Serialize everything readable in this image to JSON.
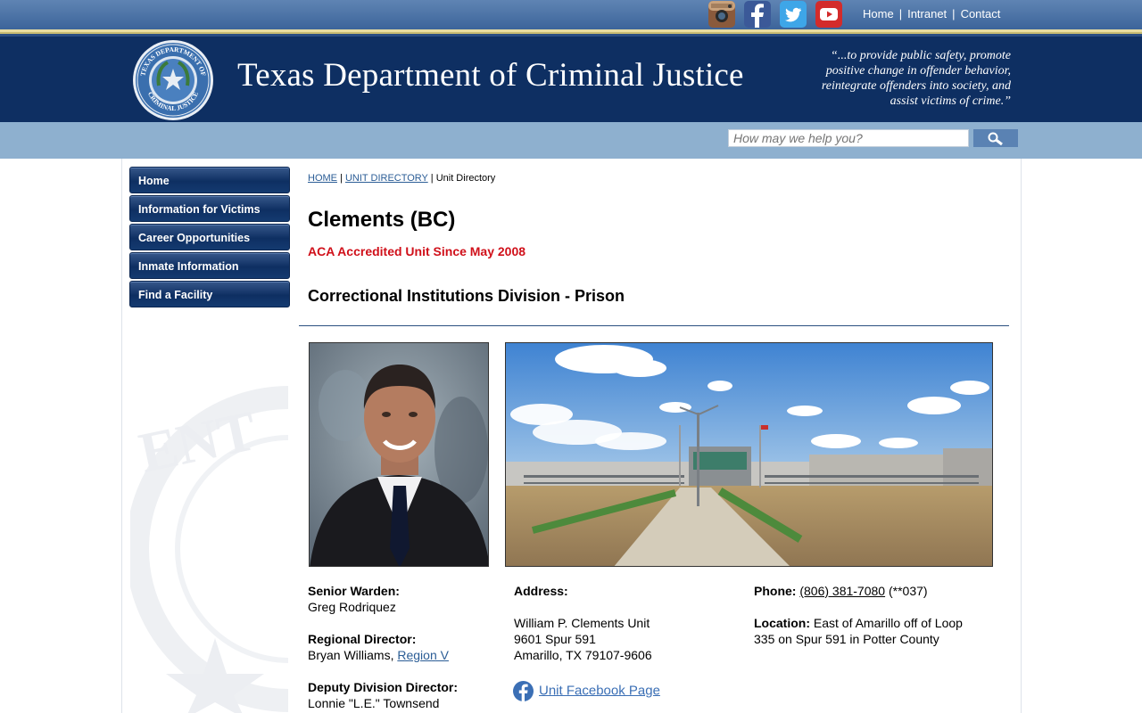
{
  "top": {
    "links": [
      "Home",
      "Intranet",
      "Contact"
    ],
    "social": [
      {
        "name": "instagram-icon",
        "color": "#8a5a3c"
      },
      {
        "name": "facebook-icon",
        "color": "#3b5998"
      },
      {
        "name": "twitter-icon",
        "color": "#3ea6e8"
      },
      {
        "name": "youtube-icon",
        "color": "#d32b2b"
      }
    ]
  },
  "header": {
    "title": "Texas Department of Criminal Justice",
    "mission": "“...to provide public safety, promote positive change in offender behavior, reintegrate offenders into society, and assist victims of crime.”",
    "seal_text_top": "TEXAS DEPARTMENT OF",
    "seal_text_bottom": "CRIMINAL JUSTICE"
  },
  "search": {
    "placeholder": "How may we help you?"
  },
  "nav": {
    "items": [
      "Home",
      "Information for Victims",
      "Career Opportunities",
      "Inmate Information",
      "Find a Facility"
    ]
  },
  "breadcrumb": {
    "home": "HOME",
    "unit_directory_link": "UNIT DIRECTORY",
    "current": "Unit Directory"
  },
  "unit": {
    "title": "Clements (BC)",
    "accreditation": "ACA Accredited Unit Since May 2008",
    "division": "Correctional Institutions Division - Prison",
    "senior_warden_label": "Senior Warden:",
    "senior_warden": "Greg Rodriquez",
    "regional_director_label": "Regional Director:",
    "regional_director": "Bryan Williams,",
    "region_link": "Region V",
    "deputy_director_label": "Deputy Division Director:",
    "deputy_director": "Lonnie \"L.E.\" Townsend",
    "address_label": "Address:",
    "address_line1": "William P. Clements Unit",
    "address_line2": "9601 Spur 591",
    "address_line3": "Amarillo, TX 79107-9606",
    "facebook_link": "Unit Facebook Page",
    "phone_label": "Phone:",
    "phone": "(806) 381-7080",
    "phone_ext": "(**037)",
    "location_label": "Location:",
    "location_line1": "East of Amarillo off of Loop",
    "location_line2": "335 on Spur 591 in Potter County"
  },
  "colors": {
    "header_navy": "#0e2f62",
    "accent_red": "#d0101a",
    "link_blue": "#2b5d96"
  }
}
